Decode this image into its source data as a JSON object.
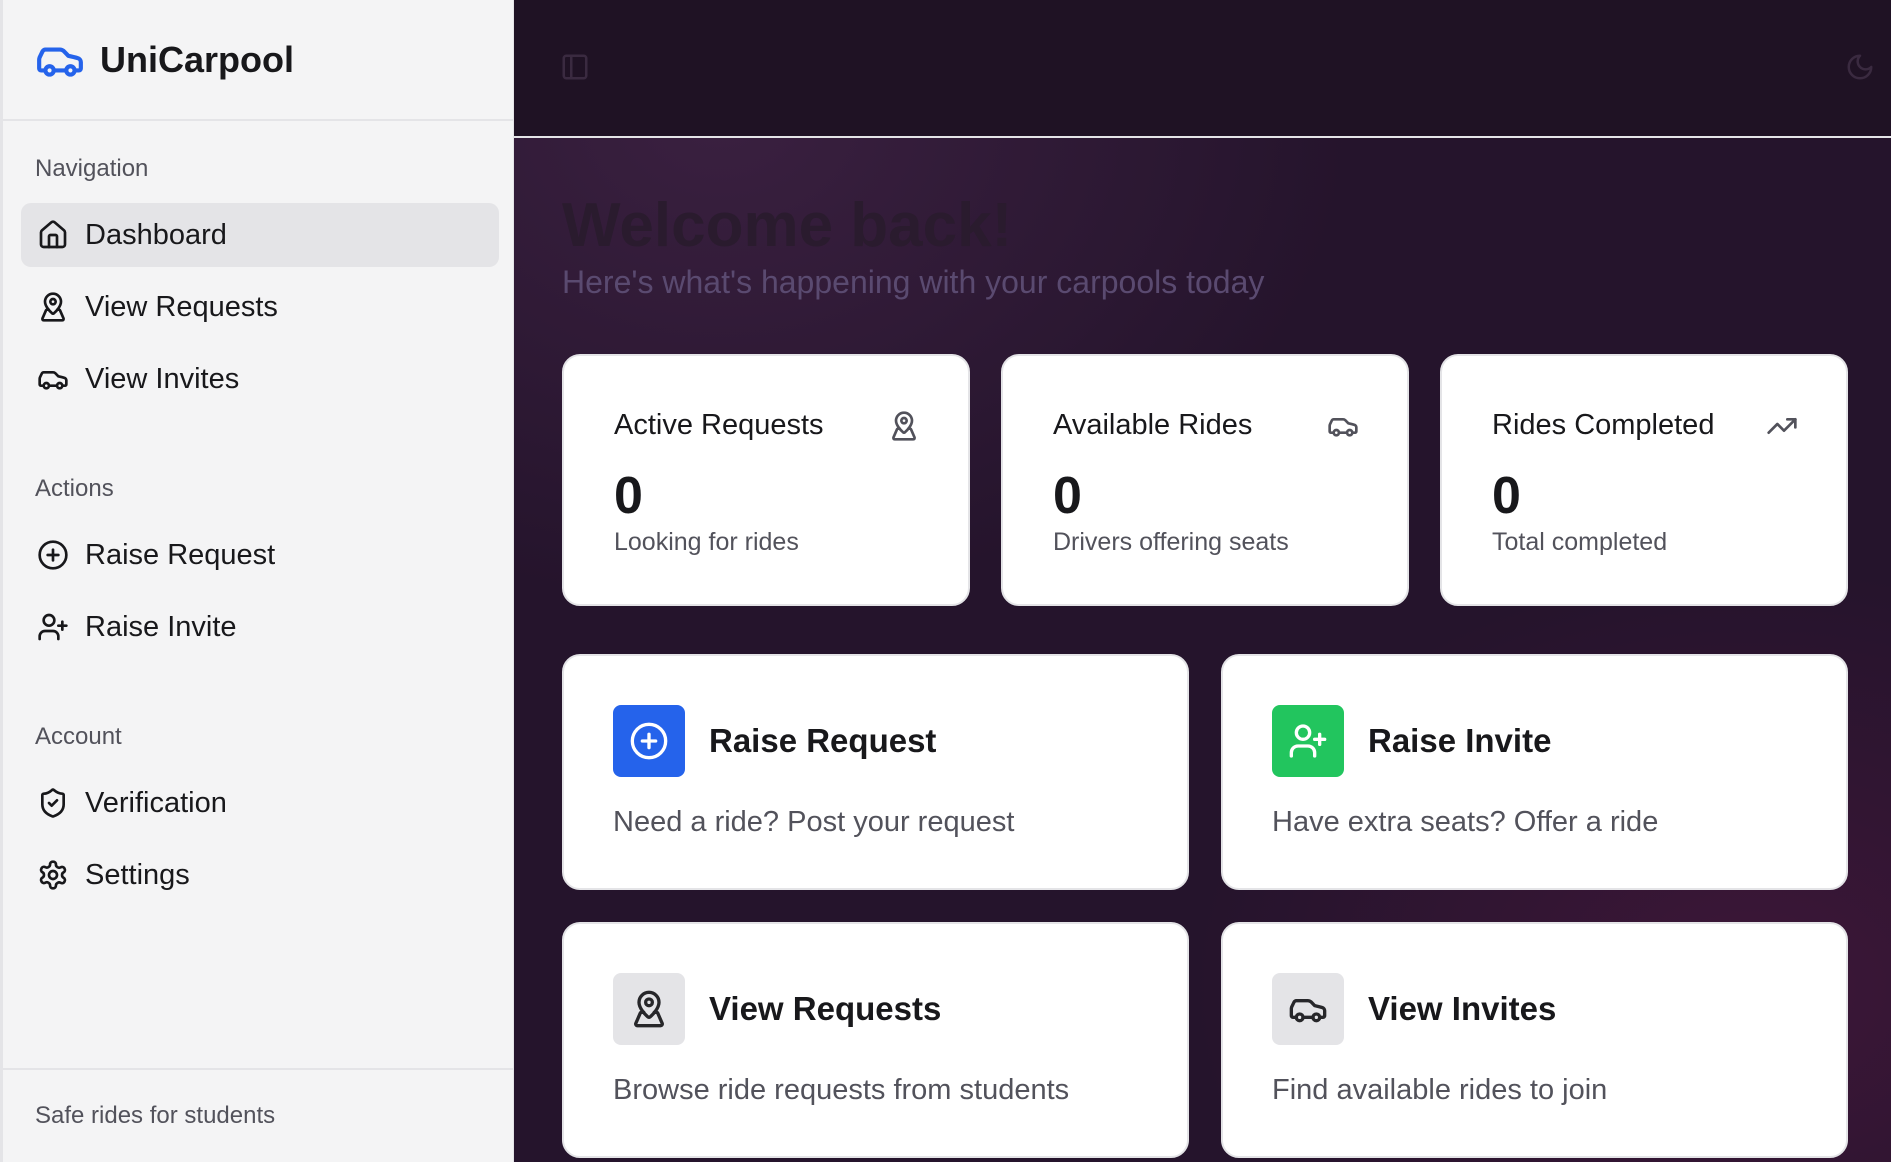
{
  "brand": {
    "name": "UniCarpool",
    "accent": "#2563eb"
  },
  "sidebar": {
    "groups": [
      {
        "label": "Navigation",
        "items": [
          {
            "label": "Dashboard",
            "icon": "home-icon",
            "active": true
          },
          {
            "label": "View Requests",
            "icon": "map-pin-user-icon"
          },
          {
            "label": "View Invites",
            "icon": "car-icon"
          }
        ]
      },
      {
        "label": "Actions",
        "items": [
          {
            "label": "Raise Request",
            "icon": "plus-circle-icon"
          },
          {
            "label": "Raise Invite",
            "icon": "user-plus-icon"
          }
        ]
      },
      {
        "label": "Account",
        "items": [
          {
            "label": "Verification",
            "icon": "shield-check-icon"
          },
          {
            "label": "Settings",
            "icon": "gear-icon"
          }
        ]
      }
    ],
    "footer": "Safe rides for students"
  },
  "main": {
    "welcome": "Welcome back!",
    "subtitle": "Here's what's happening with your carpools today",
    "stats": [
      {
        "title": "Active Requests",
        "value": "0",
        "desc": "Looking for rides",
        "icon": "map-pin-user-icon"
      },
      {
        "title": "Available Rides",
        "value": "0",
        "desc": "Drivers offering seats",
        "icon": "car-icon"
      },
      {
        "title": "Rides Completed",
        "value": "0",
        "desc": "Total completed",
        "icon": "trending-up-icon"
      }
    ],
    "actions": [
      {
        "title": "Raise Request",
        "desc": "Need a ride? Post your request",
        "icon": "plus-circle-icon",
        "color": "#2563eb"
      },
      {
        "title": "Raise Invite",
        "desc": "Have extra seats? Offer a ride",
        "icon": "user-plus-icon",
        "color": "#22c55e"
      },
      {
        "title": "View Requests",
        "desc": "Browse ride requests from students",
        "icon": "map-pin-user-icon",
        "color": "#e4e4e7"
      },
      {
        "title": "View Invites",
        "desc": "Find available rides to join",
        "icon": "car-icon",
        "color": "#e4e4e7"
      }
    ]
  }
}
